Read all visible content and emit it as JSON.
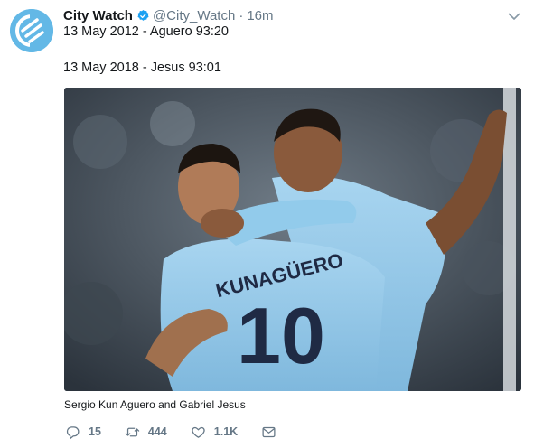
{
  "tweet": {
    "author_name": "City Watch",
    "handle": "@City_Watch",
    "separator": "·",
    "time": "16m",
    "lines": [
      "13 May 2012 - Aguero 93:20",
      "13 May 2018 - Jesus 93:01"
    ],
    "media_caption": "Sergio Kun Aguero and Gabriel Jesus",
    "jersey": {
      "name": "KUNAGÜERO",
      "number": "10"
    },
    "actions": {
      "replies": "15",
      "retweets": "444",
      "likes": "1.1K"
    }
  },
  "colors": {
    "brand_avatar": "#63b8e6",
    "verified": "#1da1f2",
    "muted": "#657786",
    "jersey_blue": "#8ec5e8"
  },
  "icons": [
    "verified-badge-icon",
    "chevron-down-icon",
    "reply-icon",
    "retweet-icon",
    "like-icon",
    "direct-message-icon"
  ]
}
